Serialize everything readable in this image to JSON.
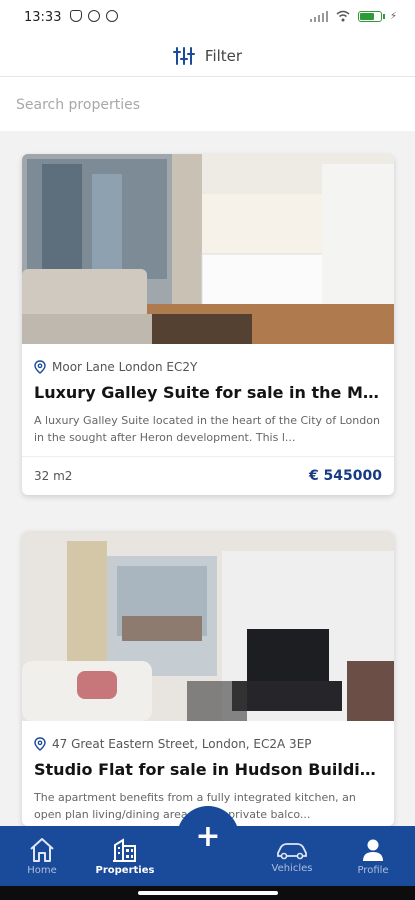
{
  "status_bar": {
    "time": "13:33",
    "icons": [
      "notifications-off-icon",
      "app-notification-icon",
      "app-notification-icon",
      "signal-icon",
      "wifi-icon",
      "battery-icon",
      "charging-icon"
    ]
  },
  "filter": {
    "label": "Filter",
    "icon": "sliders-icon"
  },
  "search": {
    "placeholder": "Search properties",
    "value": ""
  },
  "properties": [
    {
      "location": "Moor Lane London EC2Y",
      "title": "Luxury Galley Suite for sale in the Moor...",
      "description": "A luxury Galley Suite located in the heart of the City of London in the sought after Heron development. This l...",
      "area": "32 m2",
      "price": "€ 545000"
    },
    {
      "location": "47 Great Eastern Street, London, EC2A 3EP",
      "title": "Studio Flat for sale in Hudson Building,...",
      "description": "The apartment benefits from a fully integrated kitchen, an open plan living/dining area with a private balco...",
      "area": "",
      "price": ""
    }
  ],
  "bottom_nav": {
    "items": [
      {
        "label": "Home",
        "icon": "home-icon",
        "active": false
      },
      {
        "label": "Properties",
        "icon": "building-icon",
        "active": true
      },
      {
        "label": "Vehicles",
        "icon": "car-icon",
        "active": false
      },
      {
        "label": "Profile",
        "icon": "person-icon",
        "active": false
      }
    ],
    "fab_label": "+"
  },
  "colors": {
    "primary": "#1a4a9a",
    "price": "#173a85",
    "battery": "#2e9a3a"
  }
}
